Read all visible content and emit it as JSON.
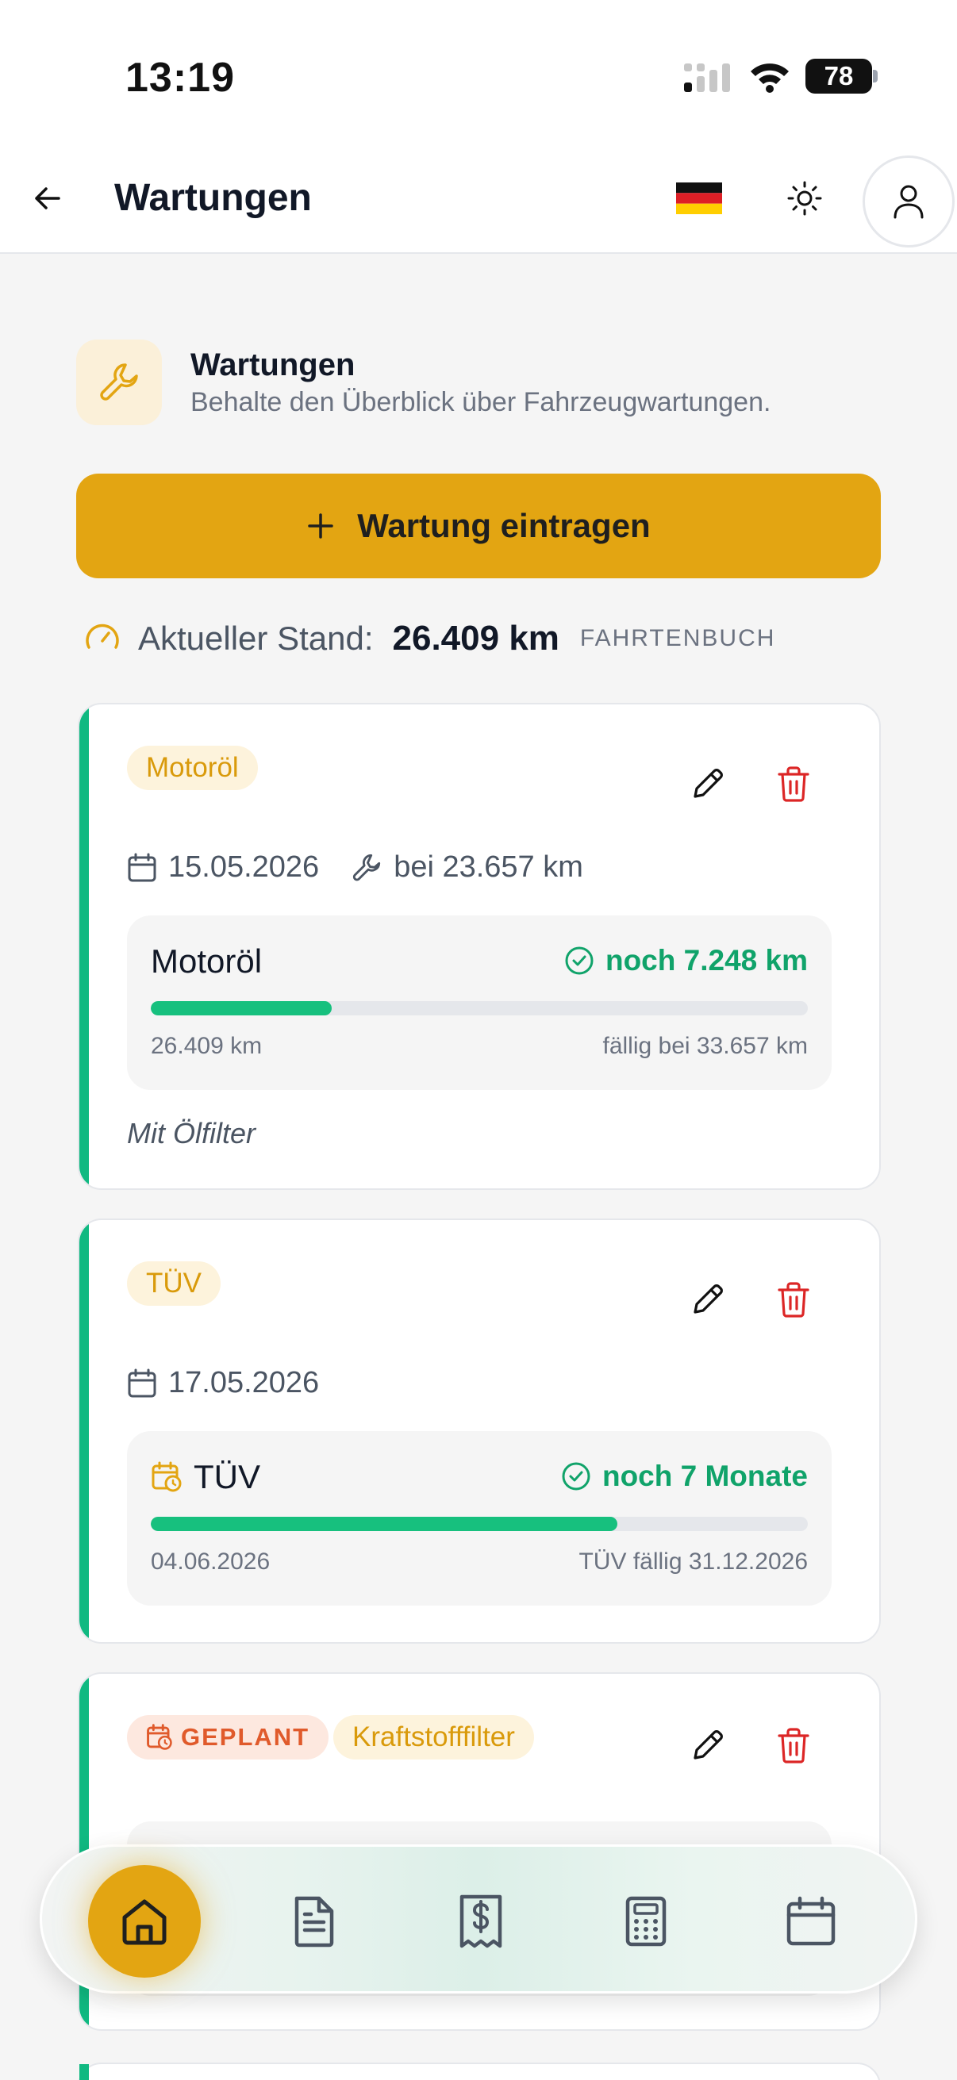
{
  "status_bar": {
    "time": "13:19",
    "battery": "78"
  },
  "appbar": {
    "title": "Wartungen",
    "language_flag": "de-flag-icon"
  },
  "section": {
    "title": "Wartungen",
    "subtitle": "Behalte den Überblick über Fahrzeugwartungen."
  },
  "add_button": {
    "label": "Wartung eintragen"
  },
  "odometer": {
    "label": "Aktueller Stand:",
    "value": "26.409 km",
    "source": "FAHRTENBUCH"
  },
  "colors": {
    "accent": "#e3a512",
    "success": "#10a36a",
    "danger": "#dc2626",
    "planned": "#e05a2b"
  },
  "cards": [
    {
      "tag": "Motoröl",
      "date": "15.05.2026",
      "mileage": "bei 23.657 km",
      "inner_title": "Motoröl",
      "status": "noch 7.248 km",
      "progress": 0.275,
      "left_label": "26.409 km",
      "right_label": "fällig bei 33.657 km",
      "note": "Mit Ölfilter"
    },
    {
      "tag": "TÜV",
      "date": "17.05.2026",
      "inner_title": "TÜV",
      "status": "noch 7 Monate",
      "progress": 0.71,
      "left_label": "04.06.2026",
      "right_label": "TÜV fällig 31.12.2026"
    },
    {
      "planned_tag": "GEPLANT",
      "tag": "Kraftstofffilter"
    }
  ],
  "bottom_nav": [
    "home-icon",
    "document-icon",
    "receipt-icon",
    "calculator-icon",
    "calendar-icon"
  ]
}
